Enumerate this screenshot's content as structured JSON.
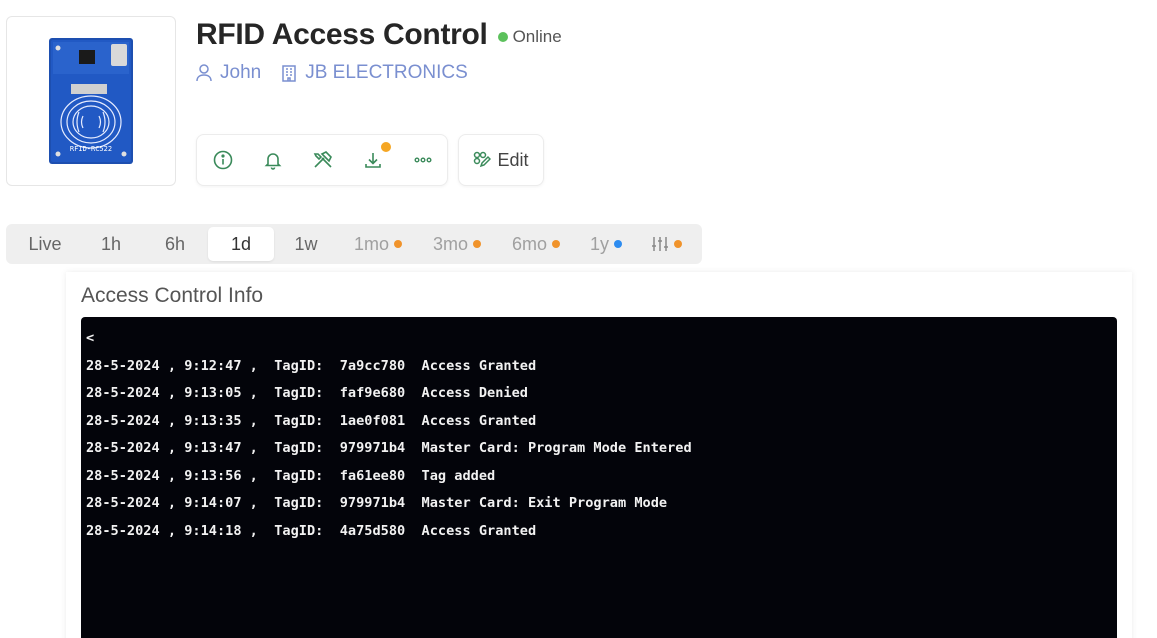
{
  "device": {
    "title": "RFID Access Control",
    "status": "Online",
    "owner": "John",
    "organization": "JB ELECTRONICS",
    "image_label": "RFID-RC522"
  },
  "toolbar": {
    "icons": [
      "info-icon",
      "bell-icon",
      "tools-icon",
      "download-icon",
      "more-icon"
    ],
    "edit_label": "Edit"
  },
  "time_ranges": [
    {
      "label": "Live"
    },
    {
      "label": "1h"
    },
    {
      "label": "6h"
    },
    {
      "label": "1d",
      "active": true
    },
    {
      "label": "1w"
    },
    {
      "label": "1mo",
      "dot": "#f0932b"
    },
    {
      "label": "3mo",
      "dot": "#f0932b"
    },
    {
      "label": "6mo",
      "dot": "#f0932b"
    },
    {
      "label": "1y",
      "dot": "#2d8cf0"
    },
    {
      "icon": "sliders-icon",
      "dot": "#f0932b"
    }
  ],
  "panel": {
    "title": "Access Control Info",
    "lines": [
      "<",
      "28-5-2024 , 9:12:47 ,  TagID:  7a9cc780  Access Granted",
      "28-5-2024 , 9:13:05 ,  TagID:  faf9e680  Access Denied",
      "28-5-2024 , 9:13:35 ,  TagID:  1ae0f081  Access Granted",
      "28-5-2024 , 9:13:47 ,  TagID:  979971b4  Master Card: Program Mode Entered",
      "28-5-2024 , 9:13:56 ,  TagID:  fa61ee80  Tag added",
      "28-5-2024 , 9:14:07 ,  TagID:  979971b4  Master Card: Exit Program Mode",
      "28-5-2024 , 9:14:18 ,  TagID:  4a75d580  Access Granted"
    ]
  },
  "colors": {
    "accent_green": "#3a8a5a",
    "link_blue": "#7a8fd0",
    "online": "#5cc15c",
    "terminal_bg": "#03040a"
  }
}
